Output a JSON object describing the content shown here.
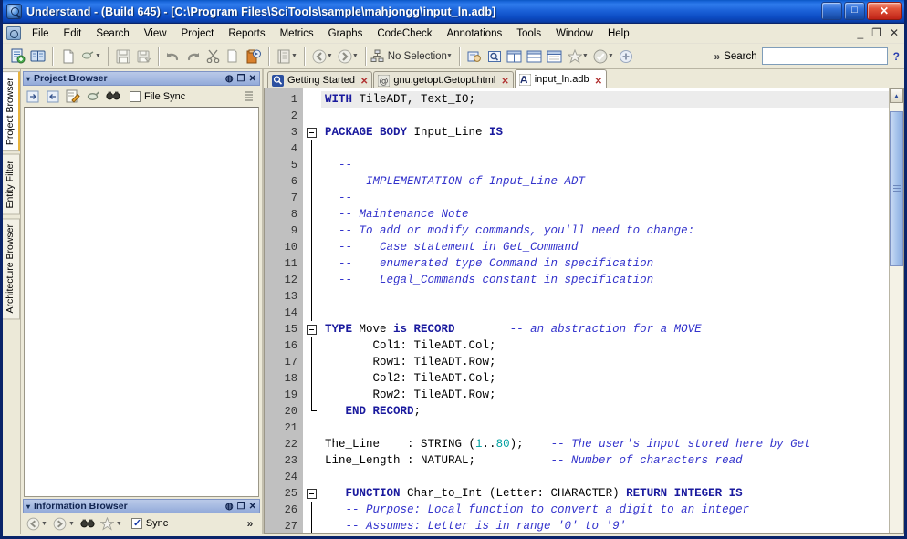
{
  "window": {
    "title": "Understand - (Build 645)  - [C:\\Program Files\\SciTools\\sample\\mahjongg\\input_ln.adb]",
    "app_icon": "understand-magnifier-icon",
    "minimize_label": "_",
    "maximize_label": "□",
    "close_label": "✕"
  },
  "menubar": {
    "items": [
      {
        "label": "File",
        "accel": "F"
      },
      {
        "label": "Edit",
        "accel": "E"
      },
      {
        "label": "Search",
        "accel": "S"
      },
      {
        "label": "View",
        "accel": "V"
      },
      {
        "label": "Project",
        "accel": "P"
      },
      {
        "label": "Reports",
        "accel": "R"
      },
      {
        "label": "Metrics",
        "accel": "M"
      },
      {
        "label": "Graphs",
        "accel": "G"
      },
      {
        "label": "CodeCheck",
        "accel": ""
      },
      {
        "label": "Annotations",
        "accel": ""
      },
      {
        "label": "Tools",
        "accel": "T"
      },
      {
        "label": "Window",
        "accel": "W"
      },
      {
        "label": "Help",
        "accel": "H"
      }
    ],
    "mdi_minimize": "_",
    "mdi_restore": "❐",
    "mdi_close": "✕"
  },
  "toolbar": {
    "buttons": [
      {
        "name": "new-project-icon",
        "glyph": "🗎"
      },
      {
        "name": "open-project-icon",
        "glyph": "📖"
      },
      {
        "name": "new-file-icon",
        "glyph": "🗋"
      },
      {
        "name": "open-file-icon",
        "glyph": "🖊"
      },
      {
        "name": "save-icon",
        "glyph": "💾"
      },
      {
        "name": "save-all-icon",
        "glyph": "💾"
      },
      {
        "name": "undo-icon",
        "glyph": "↶"
      },
      {
        "name": "redo-icon",
        "glyph": "↷"
      },
      {
        "name": "cut-icon",
        "glyph": "✂"
      },
      {
        "name": "copy-icon",
        "glyph": "⧉"
      },
      {
        "name": "paste-icon",
        "glyph": "📋"
      },
      {
        "name": "analyze-icon",
        "glyph": "☷"
      },
      {
        "name": "back-icon",
        "glyph": "←"
      },
      {
        "name": "forward-icon",
        "glyph": "→"
      }
    ],
    "selection_label": "No Selection",
    "selection_icon": "entity-tree-icon",
    "right_buttons": [
      {
        "name": "entity-locator-icon",
        "glyph": "🔎"
      },
      {
        "name": "find-in-files-icon",
        "glyph": "🔍"
      },
      {
        "name": "split-vertical-icon",
        "glyph": "◫"
      },
      {
        "name": "split-horizontal-icon",
        "glyph": "▤"
      },
      {
        "name": "new-window-icon",
        "glyph": "▣"
      },
      {
        "name": "favorites-icon",
        "glyph": "☆"
      },
      {
        "name": "check-icon",
        "glyph": "✔"
      },
      {
        "name": "add-icon",
        "glyph": "⊕"
      }
    ],
    "overflow_label": "»",
    "search_label": "Search",
    "search_value": "",
    "search_placeholder": "",
    "help_label": "?"
  },
  "side_tabs": [
    {
      "label": "Project Browser",
      "active": true
    },
    {
      "label": "Entity Filter",
      "active": false
    },
    {
      "label": "Architecture Browser",
      "active": false
    }
  ],
  "project_browser": {
    "title": "Project Browser",
    "caret": "▾",
    "float_icon": "◍",
    "dock_icon": "❐",
    "close_icon": "✕",
    "tools": [
      {
        "name": "collapse-all-icon",
        "glyph": "⇥"
      },
      {
        "name": "expand-all-icon",
        "glyph": "⇤"
      },
      {
        "name": "edit-icon",
        "glyph": "📝"
      },
      {
        "name": "attach-icon",
        "glyph": "📎"
      },
      {
        "name": "find-icon",
        "glyph": "🔍"
      }
    ],
    "file_sync_label": "File Sync",
    "file_sync_checked": false,
    "options_icon": "☰",
    "body_text": ""
  },
  "information_browser": {
    "title": "Information Browser",
    "caret": "▾",
    "float_icon": "◍",
    "dock_icon": "❐",
    "close_icon": "✕",
    "tools": [
      {
        "name": "back-icon",
        "glyph": "←"
      },
      {
        "name": "forward-icon",
        "glyph": "→"
      },
      {
        "name": "find-icon",
        "glyph": "🔍"
      },
      {
        "name": "favorite-icon",
        "glyph": "☆"
      }
    ],
    "sync_label": "Sync",
    "sync_checked": true,
    "overflow_label": "»"
  },
  "document_tabs": [
    {
      "label": "Getting Started",
      "icon": "understand-icon",
      "active": false,
      "close": "✕"
    },
    {
      "label": "gnu.getopt.Getopt.html",
      "icon": "at-sign-icon",
      "active": false,
      "close": "✕"
    },
    {
      "label": "input_ln.adb",
      "icon": "ada-file-icon",
      "active": true,
      "close": "✕"
    }
  ],
  "editor": {
    "first_line": 1,
    "current_line": 1,
    "fold_markers": [
      {
        "line": 3,
        "type": "open"
      },
      {
        "line": 15,
        "type": "open"
      },
      {
        "line": 20,
        "type": "end"
      },
      {
        "line": 25,
        "type": "open"
      }
    ],
    "scrollbar": {
      "up_arrow": "▲",
      "down_arrow": "▼",
      "thumb_top_pct": 2,
      "thumb_height_pct": 36
    },
    "lines": [
      {
        "n": 1,
        "tokens": [
          {
            "t": "kw",
            "v": "WITH"
          },
          {
            "t": "p",
            "v": " TileADT, Text_IO;"
          }
        ]
      },
      {
        "n": 2,
        "tokens": []
      },
      {
        "n": 3,
        "tokens": [
          {
            "t": "kw",
            "v": "PACKAGE BODY"
          },
          {
            "t": "p",
            "v": " Input_Line "
          },
          {
            "t": "kw",
            "v": "IS"
          }
        ]
      },
      {
        "n": 4,
        "tokens": []
      },
      {
        "n": 5,
        "tokens": [
          {
            "t": "p",
            "v": "  "
          },
          {
            "t": "cmt",
            "v": "--"
          }
        ]
      },
      {
        "n": 6,
        "tokens": [
          {
            "t": "p",
            "v": "  "
          },
          {
            "t": "cmt",
            "v": "--  IMPLEMENTATION of Input_Line ADT"
          }
        ]
      },
      {
        "n": 7,
        "tokens": [
          {
            "t": "p",
            "v": "  "
          },
          {
            "t": "cmt",
            "v": "--"
          }
        ]
      },
      {
        "n": 8,
        "tokens": [
          {
            "t": "p",
            "v": "  "
          },
          {
            "t": "cmt",
            "v": "-- Maintenance Note"
          }
        ]
      },
      {
        "n": 9,
        "tokens": [
          {
            "t": "p",
            "v": "  "
          },
          {
            "t": "cmt",
            "v": "-- To add or modify commands, you'll need to change:"
          }
        ]
      },
      {
        "n": 10,
        "tokens": [
          {
            "t": "p",
            "v": "  "
          },
          {
            "t": "cmt",
            "v": "--    Case statement in Get_Command"
          }
        ]
      },
      {
        "n": 11,
        "tokens": [
          {
            "t": "p",
            "v": "  "
          },
          {
            "t": "cmt",
            "v": "--    enumerated type Command in specification"
          }
        ]
      },
      {
        "n": 12,
        "tokens": [
          {
            "t": "p",
            "v": "  "
          },
          {
            "t": "cmt",
            "v": "--    Legal_Commands constant in specification"
          }
        ]
      },
      {
        "n": 13,
        "tokens": []
      },
      {
        "n": 14,
        "tokens": []
      },
      {
        "n": 15,
        "tokens": [
          {
            "t": "kw",
            "v": "TYPE"
          },
          {
            "t": "p",
            "v": " Move "
          },
          {
            "t": "kw",
            "v": "is RECORD"
          },
          {
            "t": "p",
            "v": "        "
          },
          {
            "t": "cmt",
            "v": "-- an abstraction for a MOVE"
          }
        ]
      },
      {
        "n": 16,
        "tokens": [
          {
            "t": "p",
            "v": "       Col1: TileADT.Col;"
          }
        ]
      },
      {
        "n": 17,
        "tokens": [
          {
            "t": "p",
            "v": "       Row1: TileADT.Row;"
          }
        ]
      },
      {
        "n": 18,
        "tokens": [
          {
            "t": "p",
            "v": "       Col2: TileADT.Col;"
          }
        ]
      },
      {
        "n": 19,
        "tokens": [
          {
            "t": "p",
            "v": "       Row2: TileADT.Row;"
          }
        ]
      },
      {
        "n": 20,
        "tokens": [
          {
            "t": "p",
            "v": "   "
          },
          {
            "t": "kw",
            "v": "END RECORD"
          },
          {
            "t": "p",
            "v": ";"
          }
        ]
      },
      {
        "n": 21,
        "tokens": []
      },
      {
        "n": 22,
        "tokens": [
          {
            "t": "p",
            "v": "The_Line    : STRING ("
          },
          {
            "t": "num",
            "v": "1"
          },
          {
            "t": "p",
            "v": ".."
          },
          {
            "t": "num",
            "v": "80"
          },
          {
            "t": "p",
            "v": ");    "
          },
          {
            "t": "cmt",
            "v": "-- The user's input stored here by Get"
          }
        ]
      },
      {
        "n": 23,
        "tokens": [
          {
            "t": "p",
            "v": "Line_Length : NATURAL;           "
          },
          {
            "t": "cmt",
            "v": "-- Number of characters read"
          }
        ]
      },
      {
        "n": 24,
        "tokens": []
      },
      {
        "n": 25,
        "tokens": [
          {
            "t": "p",
            "v": "   "
          },
          {
            "t": "kw",
            "v": "FUNCTION"
          },
          {
            "t": "p",
            "v": " Char_to_Int (Letter: CHARACTER) "
          },
          {
            "t": "kw",
            "v": "RETURN INTEGER IS"
          }
        ]
      },
      {
        "n": 26,
        "tokens": [
          {
            "t": "p",
            "v": "   "
          },
          {
            "t": "cmt",
            "v": "-- Purpose: Local function to convert a digit to an integer"
          }
        ]
      },
      {
        "n": 27,
        "tokens": [
          {
            "t": "p",
            "v": "   "
          },
          {
            "t": "cmt",
            "v": "-- Assumes: Letter is in range '0' to '9'"
          }
        ]
      }
    ]
  },
  "colors": {
    "title_blue": "#1b68dc",
    "keyword": "#1a1a9e",
    "comment": "#3333cc",
    "number": "#00a0a0",
    "gutter_bg": "#c0c0c0",
    "panel_bg": "#ece9d8",
    "panel_title_bg": "#a7bbe2"
  }
}
